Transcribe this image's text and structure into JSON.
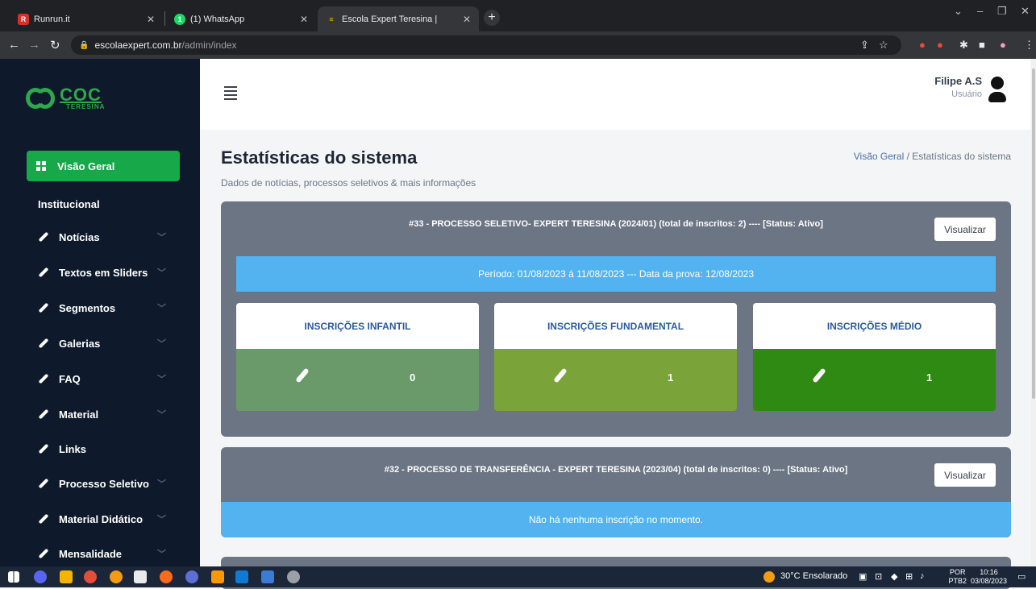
{
  "browser": {
    "tabs": [
      {
        "title": "Runrun.it",
        "active": false
      },
      {
        "title": "(1) WhatsApp",
        "active": false
      },
      {
        "title": "Escola Expert Teresina |",
        "active": true
      }
    ],
    "url_host": "escolaexpert.com.br",
    "url_path": "/admin/index"
  },
  "sidebar": {
    "logo_text": "COC",
    "logo_sub": "TERESINA",
    "active_item": "Visão Geral",
    "section": "Institucional",
    "items": [
      {
        "label": "Notícias",
        "has_submenu": true
      },
      {
        "label": "Textos em Sliders",
        "has_submenu": true
      },
      {
        "label": "Segmentos",
        "has_submenu": true
      },
      {
        "label": "Galerias",
        "has_submenu": true
      },
      {
        "label": "FAQ",
        "has_submenu": true
      },
      {
        "label": "Material",
        "has_submenu": true
      },
      {
        "label": "Links",
        "has_submenu": false
      },
      {
        "label": "Processo Seletivo",
        "has_submenu": true
      },
      {
        "label": "Material Didático",
        "has_submenu": true
      },
      {
        "label": "Mensalidade",
        "has_submenu": true
      }
    ]
  },
  "header": {
    "user_name": "Filipe A.S",
    "user_role": "Usuário"
  },
  "page": {
    "title": "Estatísticas do sistema",
    "subtitle": "Dados de notícias, processos seletivos & mais informações",
    "breadcrumb_link": "Visão Geral",
    "breadcrumb_sep": "/",
    "breadcrumb_current": "Estatísticas do sistema"
  },
  "cards": [
    {
      "title": "#33 - PROCESSO SELETIVO- EXPERT TERESINA (2024/01) (total de inscritos: 2) ---- [Status: Ativo]",
      "button": "Visualizar",
      "info": "Período: 01/08/2023 á 11/08/2023 --- Data da prova: 12/08/2023",
      "stats": [
        {
          "label": "INSCRIÇÕES INFANTIL",
          "value": "0",
          "color": "#6a9a6a"
        },
        {
          "label": "INSCRIÇÕES FUNDAMENTAL",
          "value": "1",
          "color": "#7aa33a"
        },
        {
          "label": "INSCRIÇÕES MÉDIO",
          "value": "1",
          "color": "#2e8a12"
        }
      ]
    },
    {
      "title": "#32 - PROCESSO DE TRANSFERÊNCIA - EXPERT TERESINA (2023/04) (total de inscritos: 0) ---- [Status: Ativo]",
      "button": "Visualizar",
      "info": "Não há nenhuma inscrição no momento."
    }
  ],
  "taskbar": {
    "weather": "30°C Ensolarado",
    "lang_top": "POR",
    "lang_bottom": "PTB2",
    "time": "10:16",
    "date": "03/08/2023"
  }
}
